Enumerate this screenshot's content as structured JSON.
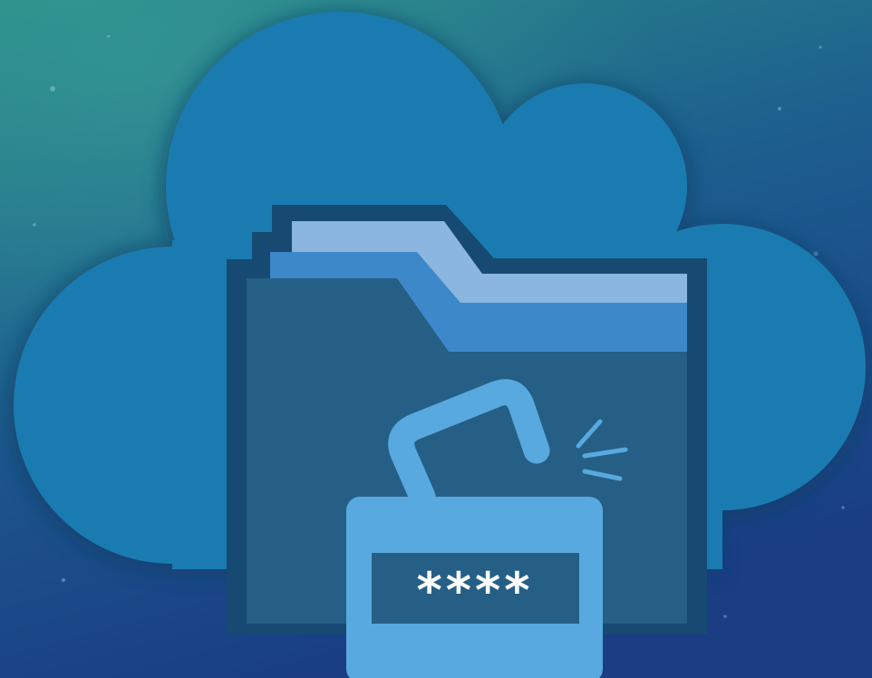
{
  "illustration": {
    "cloud": {
      "icon": "cloud-icon",
      "color": "#1a7bb0"
    },
    "folder": {
      "icon": "folder-icon",
      "color": "#255f86",
      "tab_colors": [
        "#8ab6df",
        "#3d88c9"
      ]
    },
    "padlock": {
      "icon": "unlocked-padlock-icon",
      "state": "unlocked",
      "color": "#58a9df"
    },
    "password_field": {
      "text": "****"
    },
    "background": {
      "colors": [
        "#2a8a86",
        "#1d5f8f",
        "#1a3d84"
      ]
    }
  }
}
